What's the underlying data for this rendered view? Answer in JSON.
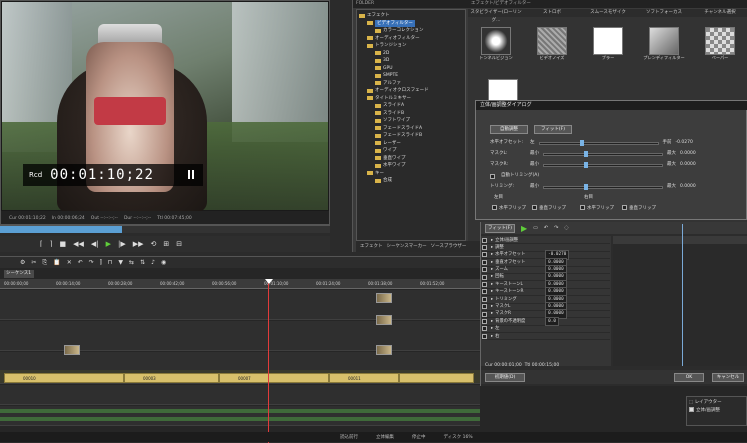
{
  "preview": {
    "rec_label": "Rcd",
    "timecode": "00:01:10;22",
    "cue_in": "Cur 00:01:10;22",
    "in_point": "In 00:00:06;24",
    "out_point": "Out --:--:--;--",
    "dur": "Dur --:--:--;--",
    "ttl": "Ttl 00:07:45;00",
    "scrub_progress": 0.37
  },
  "effects": {
    "panel_title": "FOLDER",
    "grid_title": "エフェクト/ビデオフィルター",
    "tree": [
      {
        "label": "エフェクト",
        "depth": 0
      },
      {
        "label": "ビデオフィルター",
        "depth": 1,
        "selected": true
      },
      {
        "label": "カラーコレクション",
        "depth": 2
      },
      {
        "label": "オーディオフィルター",
        "depth": 1
      },
      {
        "label": "トランジション",
        "depth": 1
      },
      {
        "label": "2D",
        "depth": 2
      },
      {
        "label": "3D",
        "depth": 2
      },
      {
        "label": "GPU",
        "depth": 2
      },
      {
        "label": "SMPTE",
        "depth": 2
      },
      {
        "label": "アルファ",
        "depth": 2
      },
      {
        "label": "オーディオクロスフェード",
        "depth": 1
      },
      {
        "label": "タイトルミキサー",
        "depth": 1
      },
      {
        "label": "スライドA",
        "depth": 2
      },
      {
        "label": "スライドB",
        "depth": 2
      },
      {
        "label": "ソフトワイプ",
        "depth": 2
      },
      {
        "label": "フェードスライドA",
        "depth": 2
      },
      {
        "label": "フェードスライドB",
        "depth": 2
      },
      {
        "label": "レーザー",
        "depth": 2
      },
      {
        "label": "ワイプ",
        "depth": 2
      },
      {
        "label": "垂直ワイプ",
        "depth": 2
      },
      {
        "label": "水平ワイプ",
        "depth": 2
      },
      {
        "label": "キー",
        "depth": 1
      },
      {
        "label": "合成",
        "depth": 2
      }
    ],
    "grid_header": [
      "スタビライザー(ローリング...",
      "ストロボ",
      "スムースモザイク",
      "ソフトフォーカス",
      "チャンネル選択"
    ],
    "row1": [
      "トンネルビジョン",
      "ビデオノイズ",
      "ブラー",
      "プレンディフィルター",
      "ペーパー"
    ],
    "row2_left": "マスク",
    "row3_left": "モーション",
    "row4_left": "明度",
    "tabs": [
      "エフェクト",
      "シーケンスマーカー",
      "ソースブラウザー"
    ]
  },
  "dialog": {
    "title": "立体/画調整ダイアログ",
    "mode": "自動調整",
    "fit_button": "フィット(F)",
    "rows": [
      {
        "label": "水平オフセット:",
        "prefix": "左",
        "suffix": "手前",
        "value": "-0.0270"
      },
      {
        "label": "マスクL:",
        "prefix": "最小",
        "suffix": "最大",
        "value": "0.0000"
      },
      {
        "label": "マスクR:",
        "prefix": "最小",
        "suffix": "最大",
        "value": "0.0000"
      },
      {
        "label": "自動トリミング(A)",
        "prefix": "",
        "suffix": "",
        "value": ""
      },
      {
        "label": "トリミング:",
        "prefix": "最小",
        "suffix": "最大",
        "value": "0.0000"
      }
    ],
    "left_group": "左目",
    "right_group": "右目",
    "hflip": "水平フリップ",
    "vflip": "垂直フリップ"
  },
  "timeline": {
    "sequence_tab": "シーケンス1",
    "ruler": [
      "00:00:00;00",
      "00:00:14;00",
      "00:00:28;00",
      "00:00:42;00",
      "00:00:56;00",
      "00:01:10;00",
      "00:01:24;00",
      "00:01:38;00",
      "00:01:52;00"
    ],
    "clips": [
      "00010",
      "00003",
      "00007",
      "00011"
    ]
  },
  "keyframe": {
    "fit_button": "フィット(F)",
    "rows": [
      {
        "label": "立体/画調整",
        "value": ""
      },
      {
        "label": "調整",
        "value": ""
      },
      {
        "label": "水平オフセット",
        "value": "-0.0270"
      },
      {
        "label": "垂直オフセット",
        "value": "0.0000"
      },
      {
        "label": "ズーム",
        "value": "0.0000"
      },
      {
        "label": "回転",
        "value": "0.0000"
      },
      {
        "label": "キーストーンL",
        "value": "0.0000"
      },
      {
        "label": "キーストーンR",
        "value": "0.0000"
      },
      {
        "label": "トリミング",
        "value": "0.0000"
      },
      {
        "label": "マスクL",
        "value": "0.0000"
      },
      {
        "label": "マスクR",
        "value": "0.0000"
      },
      {
        "label": "背景の不透明度",
        "value": "0.0"
      },
      {
        "label": "左",
        "value": ""
      },
      {
        "label": "右",
        "value": ""
      }
    ],
    "cur": "Cur 00:00:01;00",
    "ttl": "Ttl 00:00:15;00",
    "init_button": "初期値(D)",
    "ok_button": "OK",
    "cancel_button": "キャンセル"
  },
  "layer": {
    "title": "レイアウター",
    "item": "立体/画調整"
  },
  "status": [
    "読込前行",
    "立体編集",
    "停止中",
    "ディスク 16%"
  ]
}
